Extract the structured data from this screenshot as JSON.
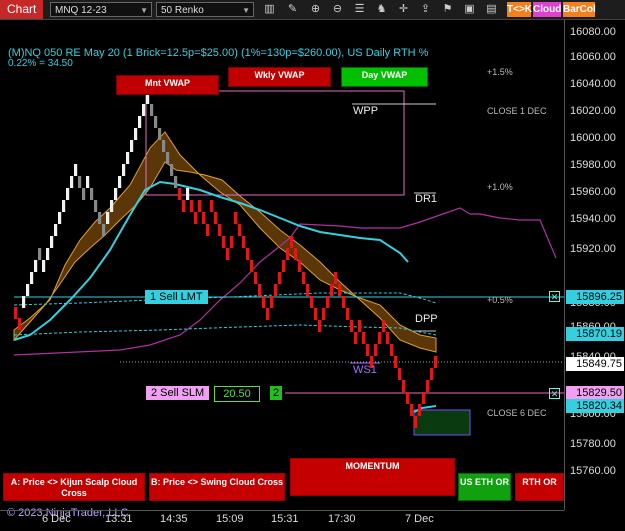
{
  "toolbar": {
    "tab_label": "Chart",
    "instrument": "MNQ 12-23",
    "bar_type": "50 Renko",
    "buttons": [
      {
        "label": "T<>K",
        "color": "#f08020"
      },
      {
        "label": "Cloud",
        "color": "#e040d0"
      },
      {
        "label": "BarCol",
        "color": "#f08020"
      }
    ],
    "icons": [
      "bar-type-icon",
      "pencil-icon",
      "zoom-in-icon",
      "zoom-out-icon",
      "properties-icon",
      "strategy-icon",
      "crosshair-icon",
      "share-icon",
      "flag-icon",
      "window-icon"
    ]
  },
  "chart": {
    "title": "(M)NQ 050 RE May 20 (1 Brick=12.5p=$25.00) (1%=130p=$260.00), US Daily RTH %",
    "subtitle": "0.22% = 34.50",
    "vwap_buttons": [
      {
        "label": "Mnt VWAP",
        "color": "#c00000"
      },
      {
        "label": "Wkly VWAP",
        "color": "#c00000"
      },
      {
        "label": "Day VWAP",
        "color": "#00c000"
      }
    ],
    "levels": {
      "pct_1_5": "+1.5%",
      "pct_1_0": "+1.0%",
      "pct_0_5": "+0.5%",
      "close_1_dec": "CLOSE 1 DEC",
      "close_6_dec": "CLOSE 6 DEC",
      "wpp": "WPP",
      "dr1": "DR1",
      "dpp": "DPP",
      "ws1": "WS1"
    },
    "orders": {
      "sell_lmt": "1 Sell LMT",
      "sell_slm": "2 Sell SLM",
      "slm_price": "20.50",
      "slm_qty": "2"
    },
    "bottom_buttons": {
      "kijun": "A: Price <> Kijun Scalp Cloud Cross",
      "swing": "B: Price <> Swing Cloud Cross",
      "momentum": "MOMENTUM",
      "us_eth": "US ETH OR",
      "rth": "RTH OR"
    },
    "copyright": "© 2023 NinjaTrader, LLC"
  },
  "yaxis": {
    "labels": [
      "16080.00",
      "16060.00",
      "16040.00",
      "16020.00",
      "16000.00",
      "15980.00",
      "15960.00",
      "15940.00",
      "15920.00",
      "15880.00",
      "15860.00",
      "15840.00",
      "15800.00",
      "15780.00",
      "15760.00"
    ],
    "tags": {
      "sell_lmt": "15896.25",
      "p15870": "15870.19",
      "last": "15849.75",
      "sell_slm": "15829.50",
      "p15820": "15820.34"
    }
  },
  "xaxis": {
    "labels": [
      "6 Dec",
      "13:31",
      "14:35",
      "15:09",
      "15:31",
      "17:30",
      "7 Dec"
    ]
  }
}
